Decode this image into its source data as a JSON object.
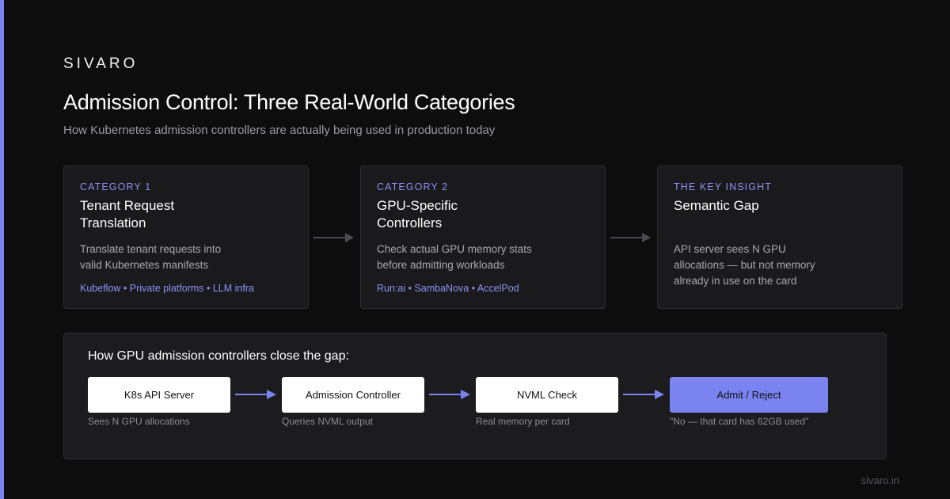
{
  "brand": "SIVARO",
  "title": "Admission Control: Three Real-World Categories",
  "subtitle": "How Kubernetes admission controllers are actually being used in production today",
  "cards": [
    {
      "tag": "CATEGORY 1",
      "title": "Tenant Request\nTranslation",
      "description": "Translate tenant requests into\nvalid Kubernetes manifests",
      "tags": "Kubeflow • Private platforms • LLM infra"
    },
    {
      "tag": "CATEGORY 2",
      "title": "GPU-Specific\nControllers",
      "description": "Check actual GPU memory stats\nbefore admitting workloads",
      "tags": "Run:ai • SambaNova • AccelPod"
    },
    {
      "tag": "THE KEY INSIGHT",
      "title": "Semantic Gap",
      "description": "API server sees N GPU\nallocations — but not memory\nalready in use on the card",
      "tags": ""
    }
  ],
  "flow": {
    "heading": "How GPU admission controllers close the gap:",
    "steps": [
      {
        "label": "K8s API Server",
        "caption": "Sees N GPU allocations"
      },
      {
        "label": "Admission Controller",
        "caption": "Queries NVML output"
      },
      {
        "label": "NVML Check",
        "caption": "Real memory per card"
      },
      {
        "label": "Admit / Reject",
        "caption": "\"No — that card has 62GB used\""
      }
    ]
  },
  "footer": "sivaro.in",
  "colors": {
    "background": "#0d0d0e",
    "accent": "#7b83f0",
    "card_background": "#1a1a1d"
  },
  "icons": [
    "arrow-right-icon"
  ]
}
